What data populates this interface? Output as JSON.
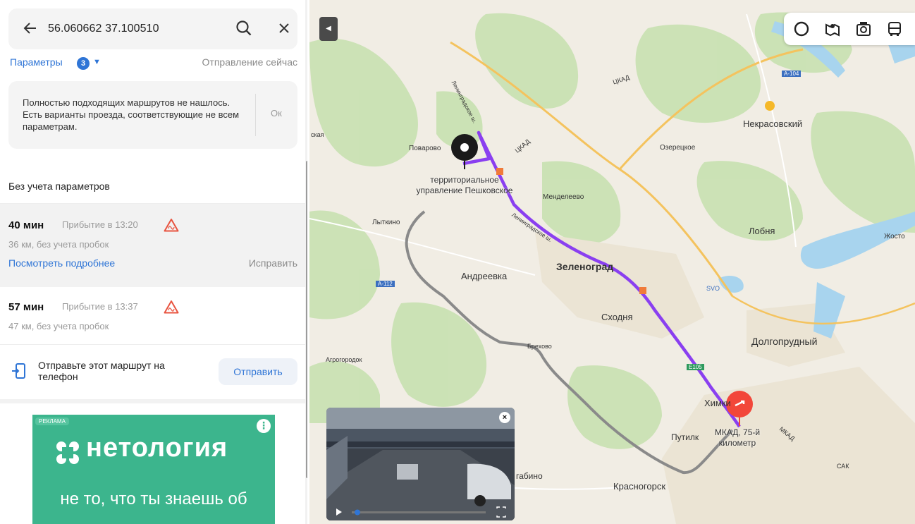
{
  "search": {
    "query": "56.060662 37.100510",
    "back_icon": "arrow-left-icon",
    "search_icon": "search-icon",
    "close_icon": "close-icon"
  },
  "params": {
    "label": "Параметры",
    "count": "3",
    "departure": "Отправление сейчас"
  },
  "notice": {
    "text": "Полностью подходящих маршрутов не нашлось. Есть варианты проезда, соответствующие не всем параметрам.",
    "ok": "Ок"
  },
  "section_label": "Без учета параметров",
  "routes": [
    {
      "duration": "40 мин",
      "arrival": "Прибытие в 13:20",
      "distance": "36 км, без учета пробок",
      "details_link": "Посмотреть подробнее",
      "fix_link": "Исправить",
      "warning_icon": "warning-triangle-icon"
    },
    {
      "duration": "57 мин",
      "arrival": "Прибытие в 13:37",
      "distance": "47 км, без учета пробок",
      "warning_icon": "warning-triangle-icon"
    }
  ],
  "phone": {
    "text": "Отправьте этот маршрут на телефон",
    "button": "Отправить",
    "icon": "phone-send-icon"
  },
  "ad": {
    "tag": "РЕКЛАМА",
    "brand": "нетология",
    "slogan": "не то, что ты знаешь об",
    "color": "#3cb58d"
  },
  "map": {
    "labels": {
      "kad1": "ЦКАД",
      "kad2": "ЦКАД",
      "a104": "А-104",
      "nekrasovsky": "Некрасовский",
      "ozeretskoe": "Озерецкое",
      "povarovo": "Поварово",
      "start_place": "территориальное управление Пешковское",
      "leningrad_hw": "Ленинградское ш.",
      "leningrad_hw2": "Ленинградское ш.",
      "mendeleevo": "Менделеево",
      "lytkino": "Лыткино",
      "lobnya": "Лобня",
      "zhosto": "Жосто",
      "a112": "А-112",
      "andreevka": "Андреевка",
      "zelenograd": "Зеленоград",
      "svo": "SVO",
      "skhodnya": "Сходня",
      "dolgoprudny": "Долгопрудный",
      "brekhovo": "Брехово",
      "agrogorodok": "Агрогородок",
      "e105": "Е105",
      "khimki": "Химки",
      "putilkovo": "Путилк",
      "end_place": "МКАД, 75-й километр",
      "mkad": "МКАД",
      "sak": "САК",
      "krasnogorsk": "Красногорск",
      "gabino": "габино",
      "left_edge": "ская"
    },
    "route_color": "#8a3ff0",
    "alt_route_color": "#8a8a8a",
    "end_pin_color": "#f2473a"
  },
  "toolbar": {
    "icons": [
      "traffic-icon",
      "panorama-icon",
      "camera-icon",
      "bus-icon"
    ]
  },
  "video": {
    "close_icon": "close-icon",
    "play_icon": "play-icon",
    "fullscreen_icon": "fullscreen-icon"
  }
}
